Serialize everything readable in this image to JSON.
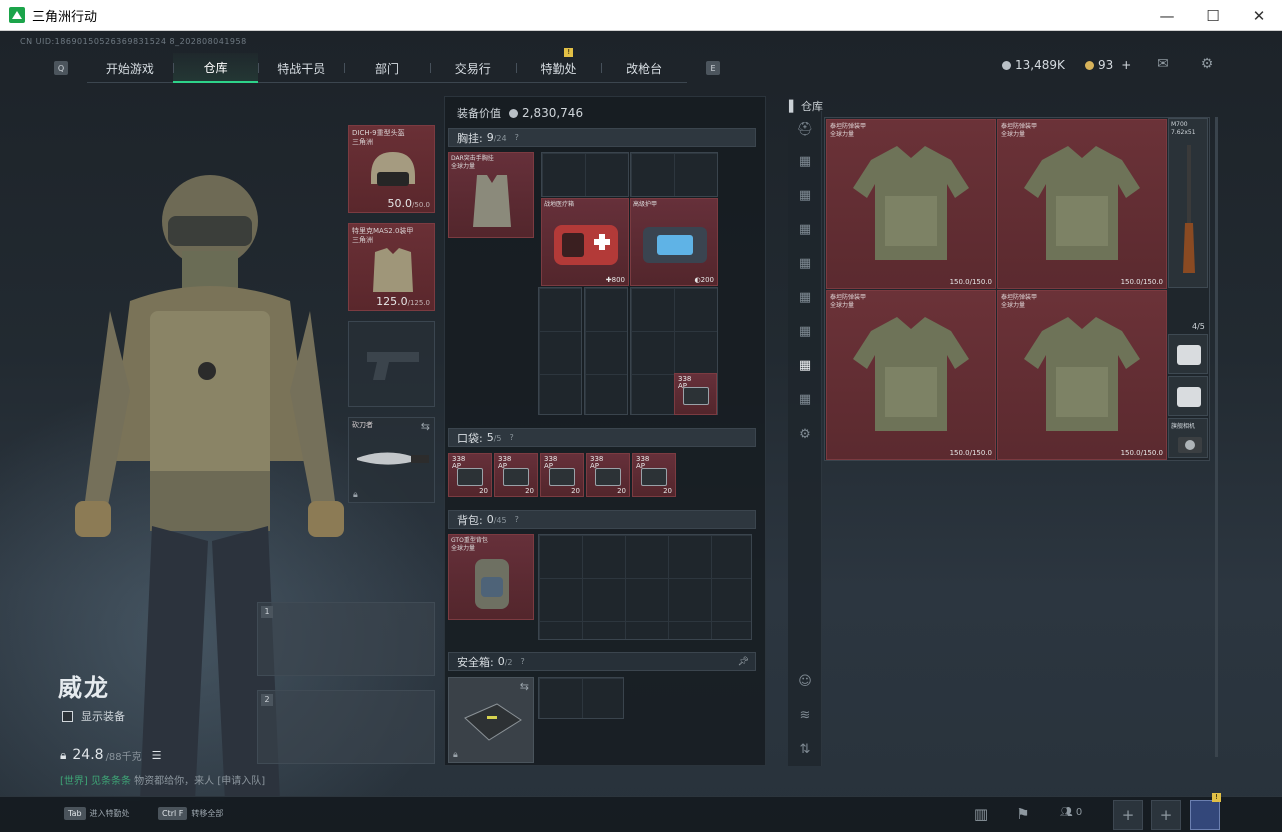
{
  "window": {
    "title": "三角洲行动",
    "minimize": "—",
    "maximize": "☐",
    "close": "✕"
  },
  "uid_text": "CN UID:18690150526369831524 8_202808041958",
  "nav": {
    "left_key": "Q",
    "right_key": "E",
    "tabs": [
      {
        "label": "开始游戏"
      },
      {
        "label": "仓库",
        "active": true
      },
      {
        "label": "特战干员"
      },
      {
        "label": "部门"
      },
      {
        "label": "交易行"
      },
      {
        "label": "特勤处",
        "alert": "!"
      },
      {
        "label": "改枪台"
      }
    ]
  },
  "currency": {
    "silver": "13,489K",
    "gold": "93",
    "gold_add": "+"
  },
  "character": {
    "name": "威龙",
    "show_equipment": "显示装备",
    "weight": "24.8",
    "weight_max": "/88千克",
    "chat": {
      "channel": "[世界]",
      "user": " 见条条条",
      "message": " 物资都给你，来人 [申请入队]"
    }
  },
  "equipment": {
    "helmet": {
      "label": "DICH-9重型头盔\n三角洲",
      "durability": "50.0",
      "max": "/50.0"
    },
    "armor": {
      "label": "特里克MAS2.0装甲\n三角洲",
      "durability": "125.0",
      "max": "/125.0"
    },
    "melee": {
      "label": "砍刀者"
    },
    "weapon_slots": [
      {
        "num": "1"
      },
      {
        "num": "2"
      }
    ]
  },
  "inventory": {
    "value_label": "装备价值",
    "value": "2,830,746",
    "chest_rig": {
      "label": "胸挂:",
      "count": "9",
      "max": "/24",
      "help": "?",
      "rig_item": "DAR突击手胸挂\n全球力量",
      "items": [
        {
          "label": "战地医疗箱",
          "qty": "800"
        },
        {
          "label": "高级护甲",
          "qty": "200"
        },
        {
          "label": "338\nAP",
          "qty": ""
        }
      ]
    },
    "pocket": {
      "label": "口袋:",
      "count": "5",
      "max": "/5",
      "help": "?",
      "items": [
        {
          "tag": "338\nAP",
          "qty": "20"
        },
        {
          "tag": "338\nAP",
          "qty": "20"
        },
        {
          "tag": "338\nAP",
          "qty": "20"
        },
        {
          "tag": "338\nAP",
          "qty": "20"
        },
        {
          "tag": "338\nAP",
          "qty": "20"
        }
      ]
    },
    "backpack": {
      "label": "背包:",
      "count": "0",
      "max": "/45",
      "help": "?",
      "bag_item": "GTO重型背包\n全球力量"
    },
    "safe_box": {
      "label": "安全箱:",
      "count": "0",
      "max": "/2",
      "help": "?"
    }
  },
  "warehouse": {
    "title": "仓库",
    "armors": [
      {
        "label": "泰坦防弹装甲\n全球力量",
        "durability": "150.0/150.0"
      },
      {
        "label": "泰坦防弹装甲\n全球力量",
        "durability": "150.0/150.0"
      },
      {
        "label": "泰坦防弹装甲\n全球力量",
        "durability": "150.0/150.0"
      },
      {
        "label": "泰坦防弹装甲\n全球力量",
        "durability": "150.0/150.0"
      }
    ],
    "rifle_label": "M700\n7.62x51",
    "stack_count": "4/5",
    "camera_label": "旗舰相机"
  },
  "bottom": {
    "hint1_key": "Tab",
    "hint1": "进入特勤处",
    "hint2_key": "Ctrl F",
    "hint2": "转移全部",
    "squad_count": "0",
    "avatar_alert": "!"
  },
  "colors": {
    "accent": "#2ed38a",
    "item_red": "#66303a",
    "panel": "#1f262c"
  }
}
